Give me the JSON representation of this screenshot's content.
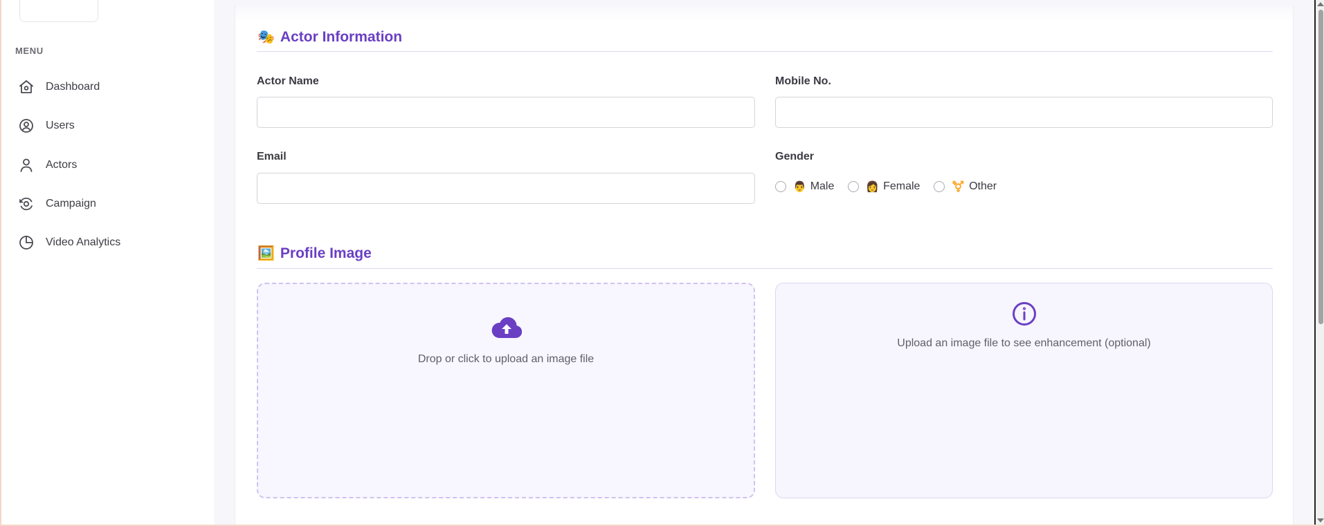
{
  "sidebar": {
    "menu_title": "MENU",
    "items": [
      {
        "label": "Dashboard",
        "icon": "home-icon"
      },
      {
        "label": "Users",
        "icon": "user-circle-icon"
      },
      {
        "label": "Actors",
        "icon": "person-icon"
      },
      {
        "label": "Campaign",
        "icon": "campaign-icon"
      },
      {
        "label": "Video Analytics",
        "icon": "pie-chart-icon"
      }
    ]
  },
  "actor_info": {
    "emoji": "🎭",
    "title": "Actor Information",
    "name_label": "Actor Name",
    "name_value": "",
    "mobile_label": "Mobile No.",
    "mobile_value": "",
    "email_label": "Email",
    "email_value": "",
    "gender_label": "Gender",
    "gender_options": [
      {
        "emoji": "👨",
        "label": "Male"
      },
      {
        "emoji": "👩",
        "label": "Female"
      },
      {
        "emoji": "⚧️",
        "label": "Other"
      }
    ]
  },
  "profile_image": {
    "emoji": "🖼️",
    "title": "Profile Image",
    "upload_text": "Drop or click to upload an image file",
    "info_text": "Upload an image file to see enhancement (optional)"
  },
  "colors": {
    "accent": "#6a3fc4",
    "section_line": "#ddd6f0"
  }
}
